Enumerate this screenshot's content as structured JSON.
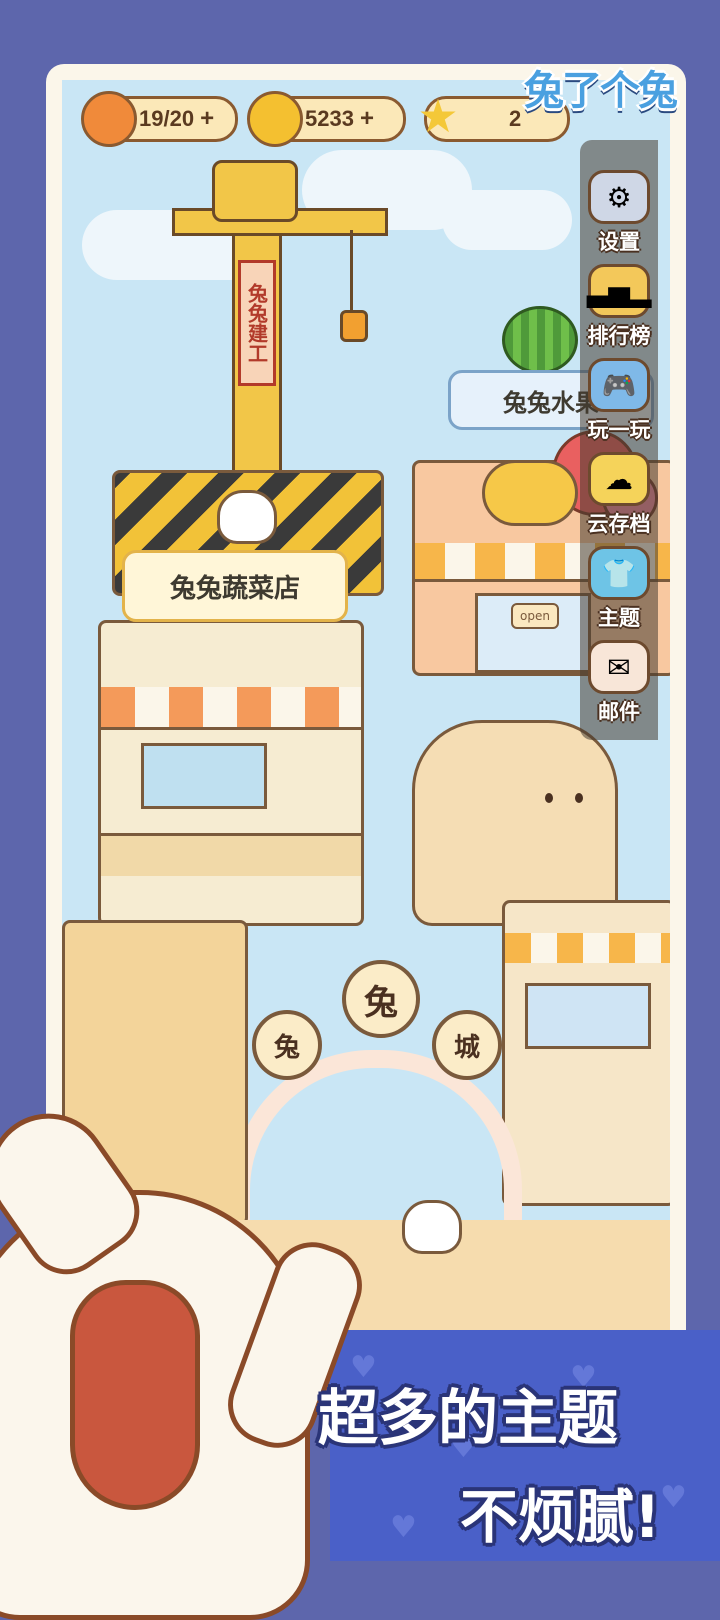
{
  "logo": {
    "title": "兔了个兔"
  },
  "resources": [
    {
      "name": "carrot",
      "icon": "carrot-icon",
      "value": "19/20",
      "plus": "+"
    },
    {
      "name": "coin",
      "icon": "coin-icon",
      "value": "5233",
      "plus": "+"
    },
    {
      "name": "star",
      "icon": "star-icon",
      "value": "2",
      "plus": ""
    }
  ],
  "sidebar": [
    {
      "label": "设置",
      "icon": "gear-icon",
      "color": "#cfd7e6"
    },
    {
      "label": "排行榜",
      "icon": "podium-icon",
      "color": "#f3c85a"
    },
    {
      "label": "玩一玩",
      "icon": "gamepad-icon",
      "color": "#7fb9e8"
    },
    {
      "label": "云存档",
      "icon": "cloud-upload-icon",
      "color": "#f5d35a"
    },
    {
      "label": "主题",
      "icon": "tshirt-icon",
      "color": "#6ec4e6"
    },
    {
      "label": "邮件",
      "icon": "mail-icon",
      "color": "#f8e6d8"
    }
  ],
  "scene": {
    "crane_sign": "兔兔建工",
    "veg_shop": "兔兔蔬菜店",
    "fruit_shop": "兔兔水果",
    "open_sign": "open",
    "arch_center": "兔",
    "arch_left": "兔",
    "arch_right": "城"
  },
  "banner": {
    "line1": "超多的主题",
    "line2": "不烦腻!"
  },
  "colors": {
    "background": "#5d66ac",
    "banner": "#4a60c8",
    "sky": "#c9e6f5"
  }
}
